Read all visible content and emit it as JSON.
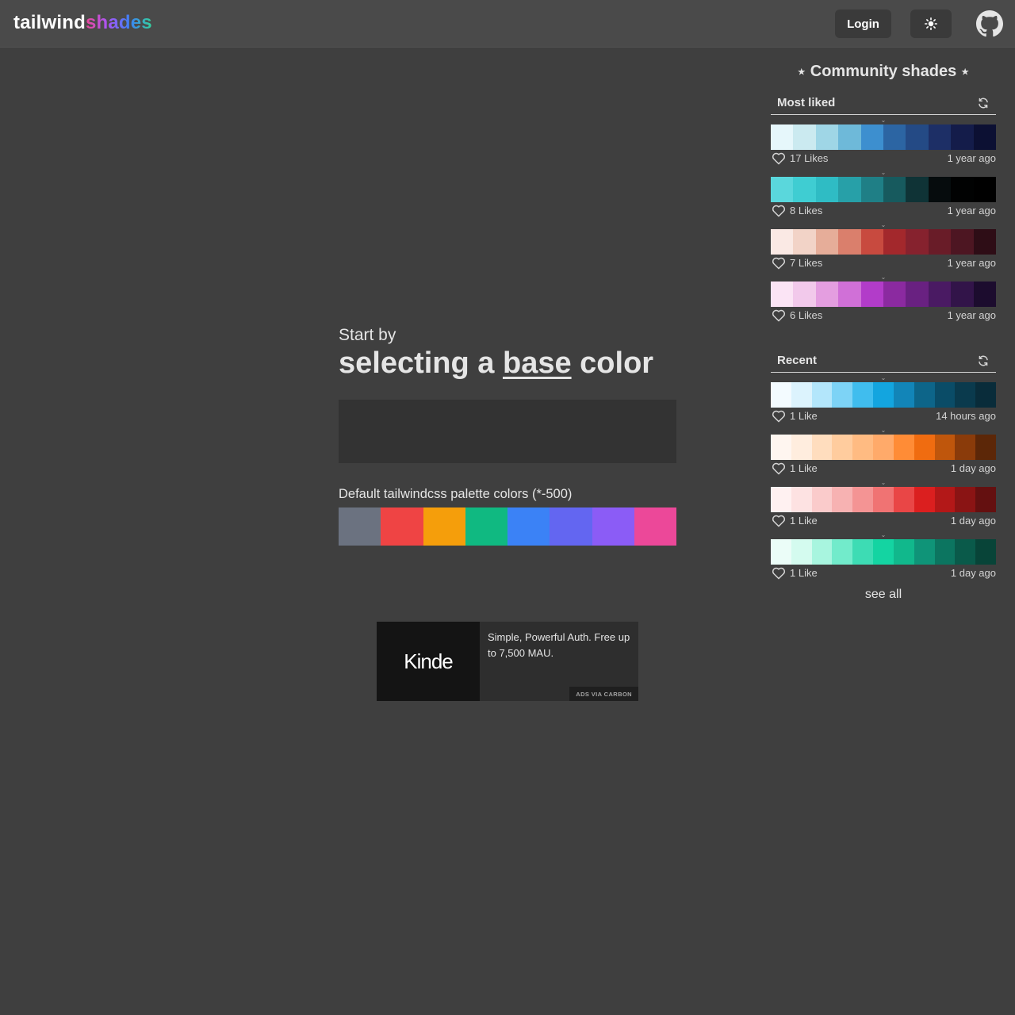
{
  "header": {
    "logo_part1": "tailwind",
    "logo_part2": "shades",
    "login_label": "Login",
    "theme_icon": "sun-icon",
    "github_icon": "github-icon"
  },
  "main": {
    "start_text": "Start by",
    "headline_pre": "selecting a ",
    "headline_emph": "base",
    "headline_post": " color",
    "color_input_value": "",
    "default_label": "Default tailwindcss palette colors (*-500)",
    "default_colors": [
      "#6b7280",
      "#ef4444",
      "#f59e0b",
      "#10b981",
      "#3b82f6",
      "#6366f1",
      "#8b5cf6",
      "#ec4899"
    ]
  },
  "ad": {
    "logo_text": "Kinde",
    "text": "Simple, Powerful Auth. Free up to 7,500 MAU.",
    "via": "ADS VIA CARBON"
  },
  "sidebar": {
    "title": "Community shades",
    "star": "★",
    "chevron": "⌄",
    "see_all": "see all",
    "sections": [
      {
        "title": "Most liked",
        "palettes": [
          {
            "likes": "17 Likes",
            "ago": "1 year ago",
            "colors": [
              "#e6f7fb",
              "#cbeaf0",
              "#9fd6e6",
              "#6eb9d9",
              "#3d8fcf",
              "#2c65a3",
              "#244a85",
              "#1d2f66",
              "#141c4a",
              "#0c1033"
            ]
          },
          {
            "likes": "8 Likes",
            "ago": "1 year ago",
            "colors": [
              "#5ad7dc",
              "#3fcdd2",
              "#2fbcc4",
              "#27a0a8",
              "#1f7f86",
              "#175a5e",
              "#0f3336",
              "#060c0d",
              "#010202",
              "#000000"
            ]
          },
          {
            "likes": "7 Likes",
            "ago": "1 year ago",
            "colors": [
              "#fae9e4",
              "#f2d3c7",
              "#e6ad99",
              "#da7f6c",
              "#c84a3f",
              "#a3282c",
              "#86222e",
              "#691c28",
              "#4d1622",
              "#2e0d16"
            ]
          },
          {
            "likes": "6 Likes",
            "ago": "1 year ago",
            "colors": [
              "#fbe4f5",
              "#f2c9eb",
              "#e49ee0",
              "#d070d7",
              "#b23cc9",
              "#8b2aa0",
              "#692181",
              "#4a1a63",
              "#321449",
              "#1c0c2e"
            ]
          }
        ]
      },
      {
        "title": "Recent",
        "palettes": [
          {
            "likes": "1 Like",
            "ago": "14 hours ago",
            "colors": [
              "#f3fbff",
              "#dcf3fd",
              "#b3e6fb",
              "#7dd3f6",
              "#40bdee",
              "#13a5df",
              "#1285b8",
              "#0d6589",
              "#0a4c67",
              "#0a3a4d",
              "#092c3a"
            ]
          },
          {
            "likes": "1 Like",
            "ago": "1 day ago",
            "colors": [
              "#fff6f0",
              "#ffedde",
              "#ffddbe",
              "#ffcc9e",
              "#ffbb82",
              "#ffaa6a",
              "#ff8c36",
              "#f06c10",
              "#bf560c",
              "#8a3b0a",
              "#5c2708"
            ]
          },
          {
            "likes": "1 Like",
            "ago": "1 day ago",
            "colors": [
              "#fff1f1",
              "#fde2e2",
              "#facbcb",
              "#f7b2b2",
              "#f49494",
              "#f07373",
              "#e94646",
              "#db1f1f",
              "#b31818",
              "#8a1414",
              "#641010"
            ]
          },
          {
            "likes": "1 Like",
            "ago": "1 day ago",
            "colors": [
              "#ebfdf8",
              "#d4fbef",
              "#a8f5df",
              "#72ebcb",
              "#3ddcb4",
              "#14d4a2",
              "#11b88c",
              "#0f9478",
              "#0c7560",
              "#0a5a4a",
              "#084438"
            ]
          }
        ]
      }
    ]
  }
}
